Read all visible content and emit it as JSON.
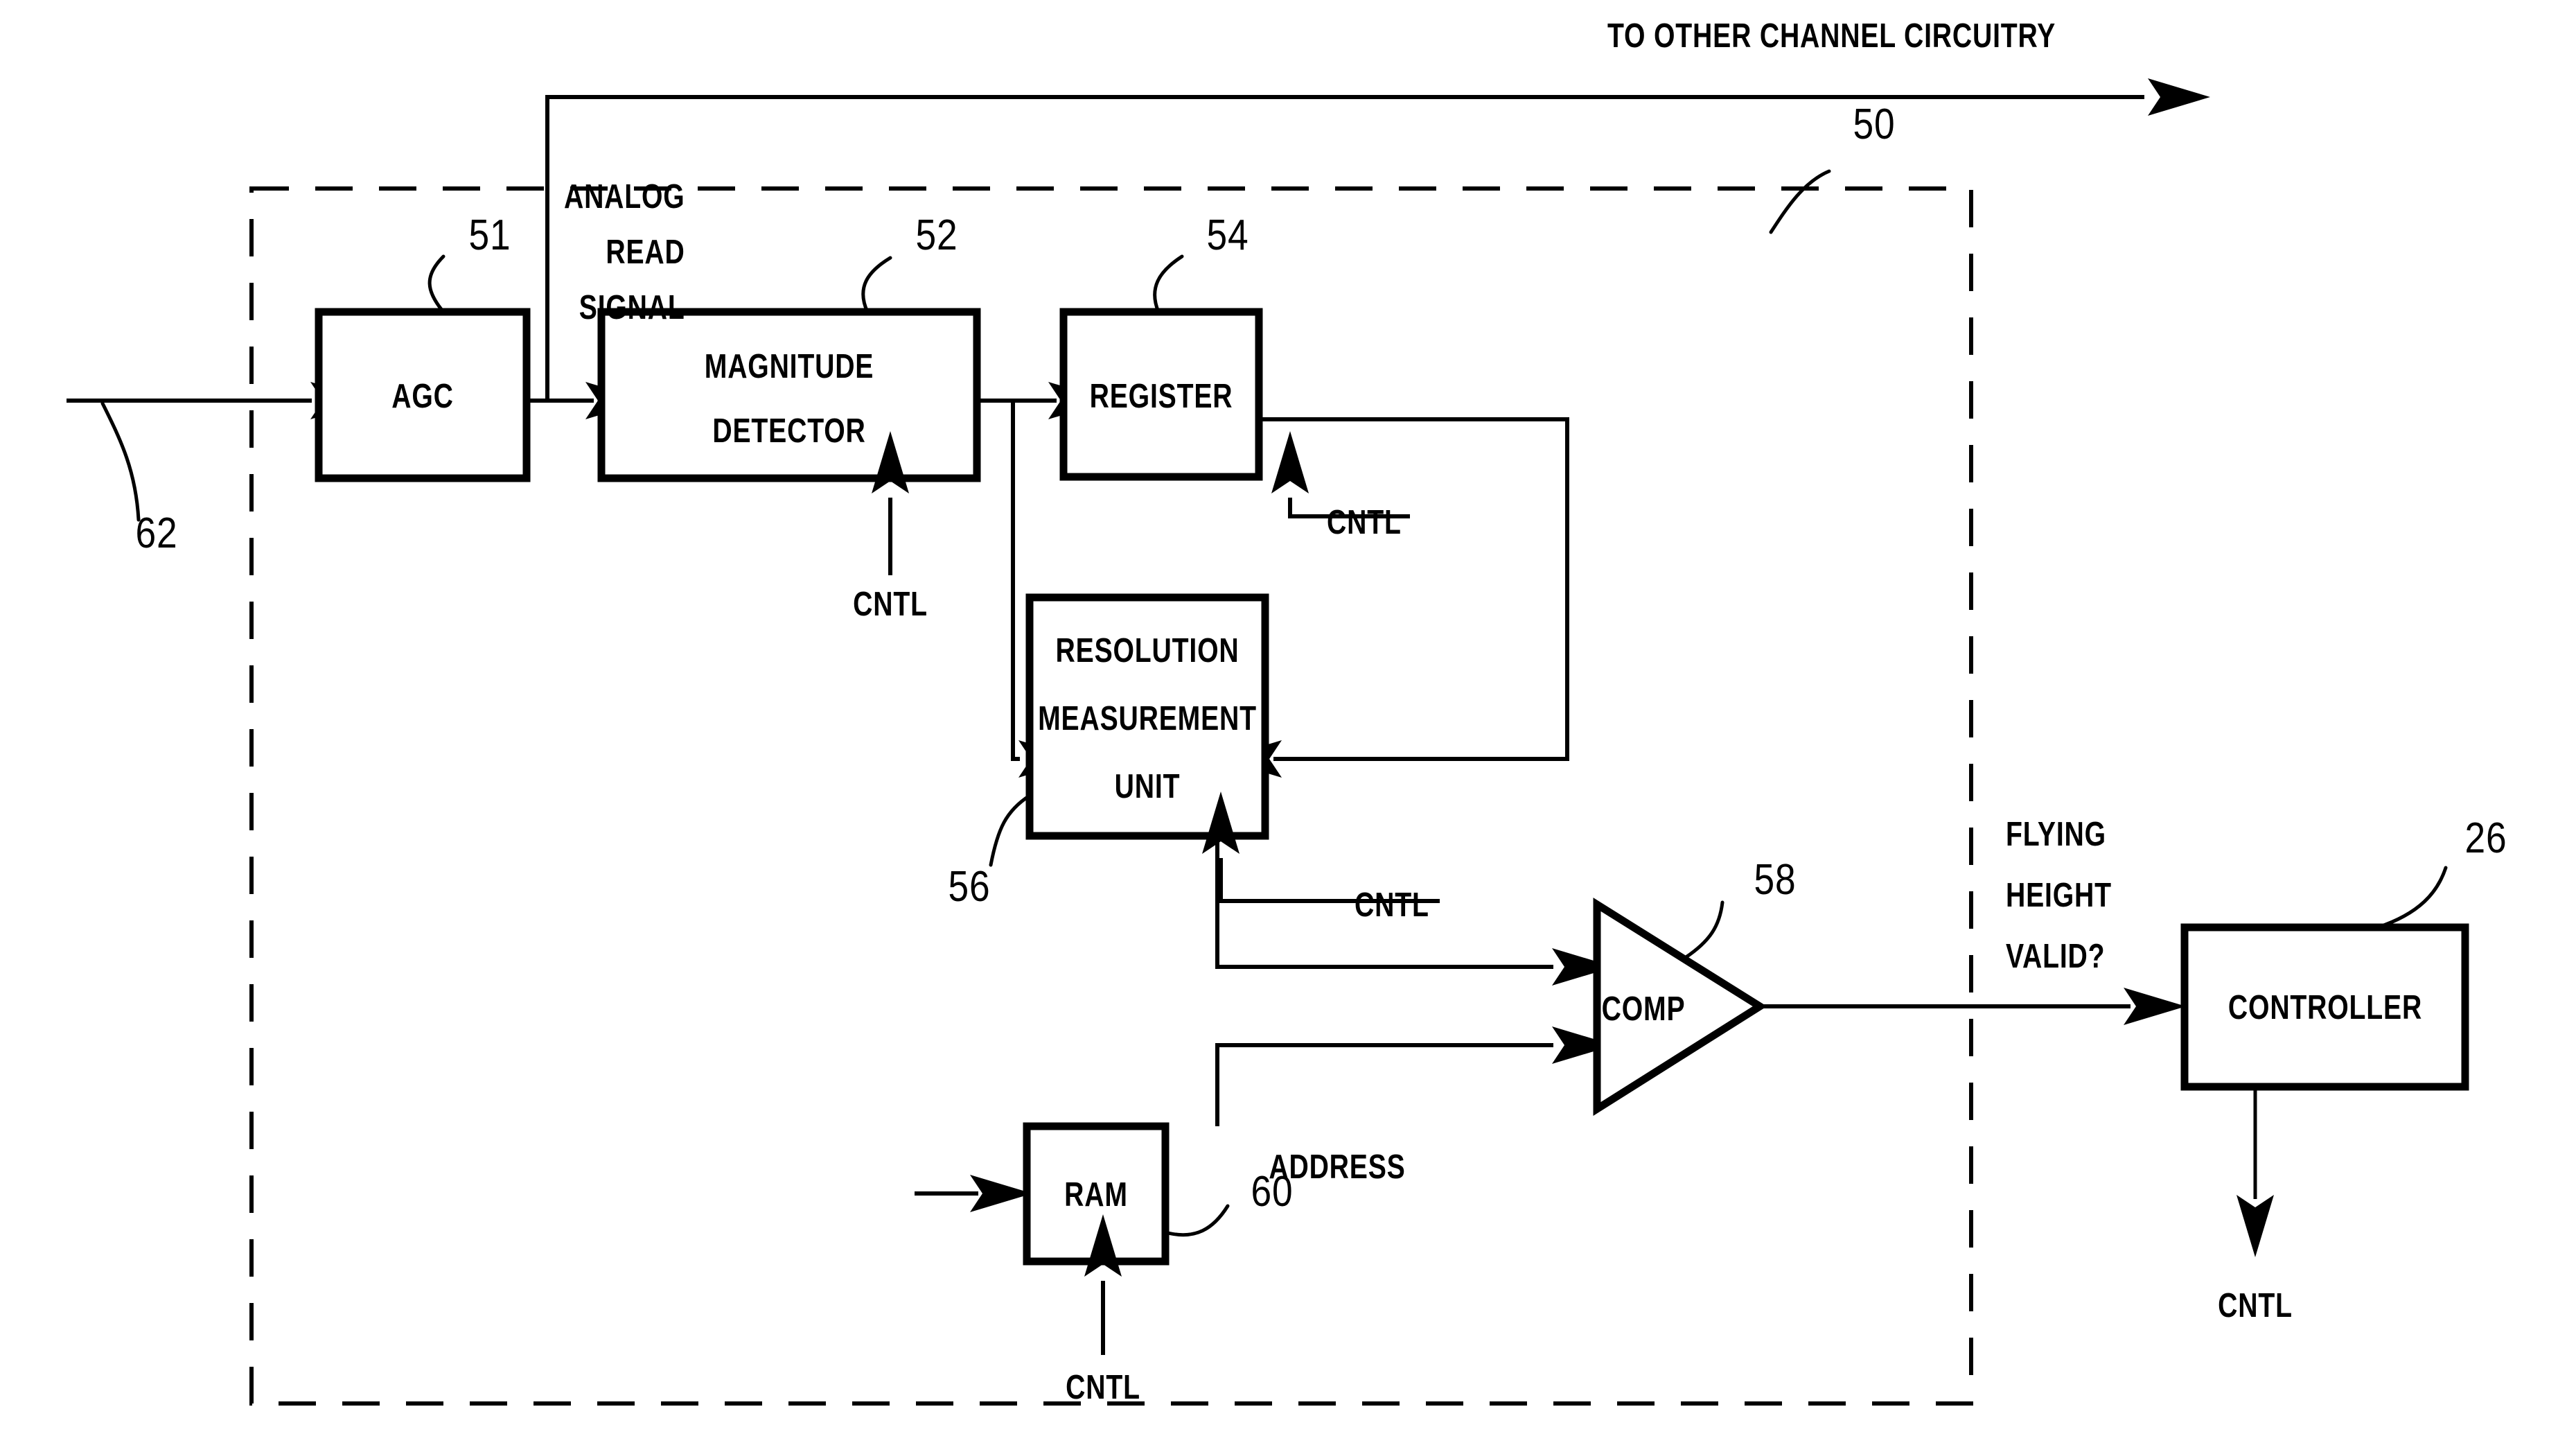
{
  "figure": {
    "kind": "patent-block-diagram",
    "title_text": "TO OTHER CHANNEL CIRCUITRY",
    "enclosure_ref": "50"
  },
  "blocks": [
    {
      "id": "agc",
      "label": "AGC",
      "ref": "51"
    },
    {
      "id": "magdet",
      "label_line1": "MAGNITUDE",
      "label_line2": "DETECTOR",
      "ref": "52"
    },
    {
      "id": "register",
      "label": "REGISTER",
      "ref": "54"
    },
    {
      "id": "rmu",
      "label_line1": "RESOLUTION",
      "label_line2": "MEASUREMENT",
      "label_line3": "UNIT",
      "ref": "56"
    },
    {
      "id": "comp",
      "label": "COMP",
      "ref": "58"
    },
    {
      "id": "ram",
      "label": "RAM",
      "ref": "60"
    },
    {
      "id": "controller",
      "label": "CONTROLLER",
      "ref": "26"
    }
  ],
  "signals": {
    "analog_read_line1": "ANALOG",
    "analog_read_line2": "READ",
    "analog_read_line3": "SIGNAL",
    "analog_read_ref": "62",
    "address": "ADDRESS",
    "flying_height_line1": "FLYING",
    "flying_height_line2": "HEIGHT",
    "flying_height_line3": "VALID?",
    "cntl_magdet": "CNTL",
    "cntl_register": "CNTL",
    "cntl_rmu": "CNTL",
    "cntl_ram": "CNTL",
    "cntl_controller": "CNTL"
  },
  "colors": {
    "ink": "#000000",
    "paper": "#ffffff"
  }
}
